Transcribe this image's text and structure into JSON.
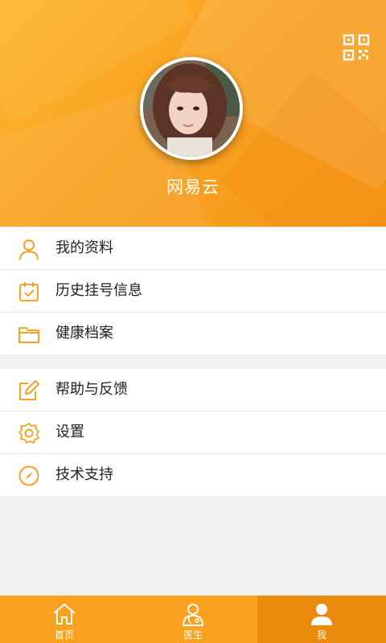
{
  "colors": {
    "accent": "#f9a21f",
    "accent_dark": "#e98a0c",
    "background": "#f1f1f1"
  },
  "header": {
    "qr_icon": "qr-code-icon",
    "avatar": "user-avatar-photo",
    "username": "网易云"
  },
  "menu_group_1": [
    {
      "label": "我的资料",
      "icon": "user-icon"
    },
    {
      "label": "历史挂号信息",
      "icon": "calendar-check-icon"
    },
    {
      "label": "健康档案",
      "icon": "folder-icon"
    }
  ],
  "menu_group_2": [
    {
      "label": "帮助与反馈",
      "icon": "edit-icon"
    },
    {
      "label": "设置",
      "icon": "gear-icon"
    },
    {
      "label": "技术支持",
      "icon": "compass-icon"
    }
  ],
  "tabbar": [
    {
      "label": "首页",
      "icon": "home-icon",
      "active": false
    },
    {
      "label": "医生",
      "icon": "doctor-icon",
      "active": false
    },
    {
      "label": "我",
      "icon": "person-icon",
      "active": true
    }
  ]
}
